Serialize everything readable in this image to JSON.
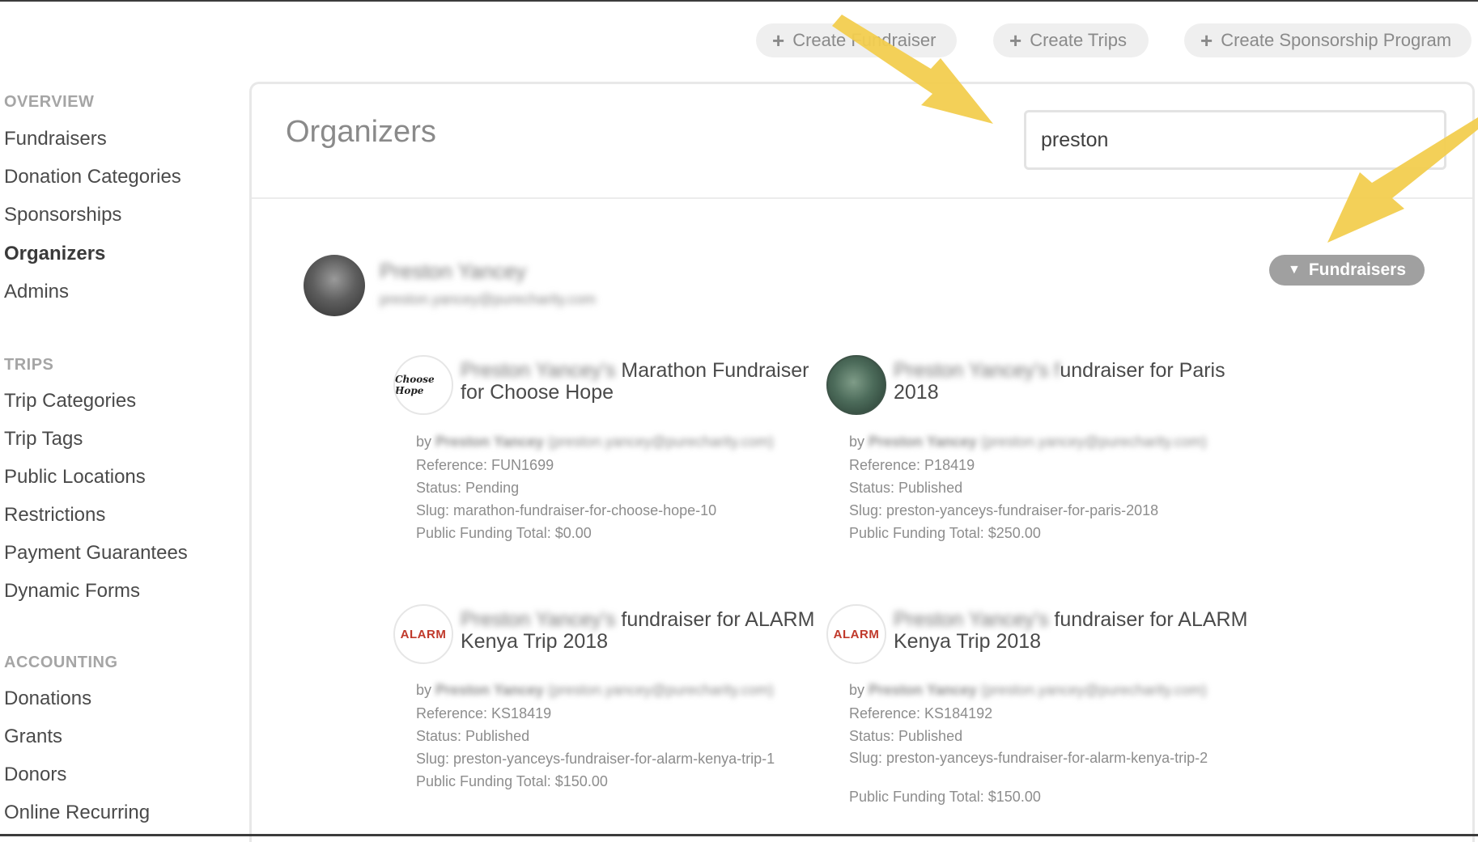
{
  "top_actions": [
    {
      "label": "Create Fundraiser"
    },
    {
      "label": "Create Trips"
    },
    {
      "label": "Create Sponsorship Program"
    }
  ],
  "sidebar": {
    "sections": [
      {
        "heading": "OVERVIEW",
        "items": [
          "Fundraisers",
          "Donation Categories",
          "Sponsorships",
          "Organizers",
          "Admins"
        ]
      },
      {
        "heading": "TRIPS",
        "items": [
          "Trip Categories",
          "Trip Tags",
          "Public Locations",
          "Restrictions",
          "Payment Guarantees",
          "Dynamic Forms"
        ]
      },
      {
        "heading": "ACCOUNTING",
        "items": [
          "Donations",
          "Grants",
          "Donors",
          "Online Recurring"
        ]
      }
    ],
    "active_item": "Organizers"
  },
  "main": {
    "title": "Organizers",
    "search": {
      "value": "preston"
    },
    "organizer": {
      "name": "Preston Yancey",
      "email": "preston.yancey@purecharity.com",
      "filter_label": "Fundraisers"
    },
    "cards": [
      {
        "title_blurred": "Preston Yancey's",
        "title_visible": " Marathon Fundraiser for Choose Hope",
        "thumb": "Choose Hope",
        "by_label": "by",
        "by_name": "Preston Yancey",
        "by_email": "(preston.yancey@purecharity.com)",
        "reference": "Reference: FUN1699",
        "status": "Status: Pending",
        "slug": "Slug: marathon-fundraiser-for-choose-hope-10",
        "funding": "Public Funding Total: $0.00"
      },
      {
        "title_blurred": "Preston Yancey's f",
        "title_visible": "undraiser for Paris 2018",
        "thumb": "",
        "by_label": "by",
        "by_name": "Preston Yancey",
        "by_email": "(preston.yancey@purecharity.com)",
        "reference": "Reference: P18419",
        "status": "Status: Published",
        "slug": "Slug: preston-yanceys-fundraiser-for-paris-2018",
        "funding": "Public Funding Total: $250.00"
      },
      {
        "title_blurred": "Preston Yancey's",
        "title_visible": " fundraiser for ALARM Kenya Trip 2018",
        "thumb": "ALARM",
        "by_label": "by",
        "by_name": "Preston Yancey",
        "by_email": "(preston.yancey@purecharity.com)",
        "reference": "Reference: KS18419",
        "status": "Status: Published",
        "slug": "Slug: preston-yanceys-fundraiser-for-alarm-kenya-trip-1",
        "funding": "Public Funding Total: $150.00"
      },
      {
        "title_blurred": "Preston Yancey's",
        "title_visible": " fundraiser for ALARM Kenya Trip 2018",
        "thumb": "ALARM",
        "by_label": "by",
        "by_name": "Preston Yancey",
        "by_email": "(preston.yancey@purecharity.com)",
        "reference": "Reference: KS184192",
        "status": "Status: Published",
        "slug": "Slug: preston-yanceys-fundraiser-for-alarm-kenya-trip-2",
        "funding": "Public Funding Total: $150.00"
      }
    ]
  },
  "colors": {
    "arrow": "#f2cd4f",
    "filter_button": "#a0a0a0",
    "accent_text": "#4a4a4a"
  }
}
